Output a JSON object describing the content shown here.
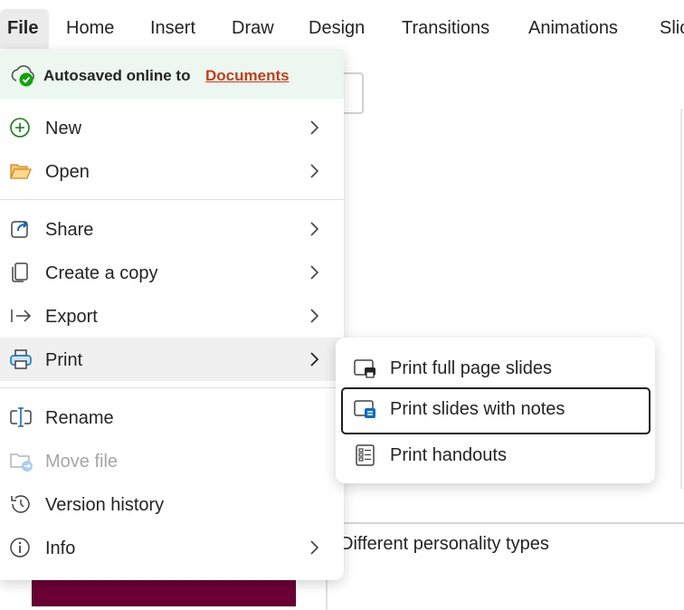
{
  "ribbon": {
    "tabs": [
      {
        "label": "File"
      },
      {
        "label": "Home"
      },
      {
        "label": "Insert"
      },
      {
        "label": "Draw"
      },
      {
        "label": "Design"
      },
      {
        "label": "Transitions"
      },
      {
        "label": "Animations"
      },
      {
        "label": "Slic"
      }
    ]
  },
  "file_menu": {
    "autosave": {
      "label": "Autosaved online to",
      "link": "Documents",
      "icon": "cloud-check-icon"
    },
    "items": [
      {
        "label": "New",
        "icon": "plus-circle-icon",
        "submenu": true
      },
      {
        "label": "Open",
        "icon": "folder-icon",
        "submenu": true
      },
      {
        "label": "Share",
        "icon": "share-icon",
        "submenu": true
      },
      {
        "label": "Create a copy",
        "icon": "copy-icon",
        "submenu": true
      },
      {
        "label": "Export",
        "icon": "export-arrow-icon",
        "submenu": true
      },
      {
        "label": "Print",
        "icon": "printer-icon",
        "submenu": true,
        "active": true
      },
      {
        "label": "Rename",
        "icon": "rename-icon",
        "submenu": false
      },
      {
        "label": "Move file",
        "icon": "move-file-icon",
        "submenu": false,
        "disabled": true
      },
      {
        "label": "Version history",
        "icon": "history-icon",
        "submenu": false
      },
      {
        "label": "Info",
        "icon": "info-icon",
        "submenu": true
      }
    ]
  },
  "print_submenu": {
    "items": [
      {
        "label": "Print full page slides",
        "icon": "print-full-page-icon"
      },
      {
        "label": "Print slides with notes",
        "icon": "print-notes-icon",
        "focused": true
      },
      {
        "label": "Print handouts",
        "icon": "handouts-icon"
      }
    ]
  },
  "slide_area": {
    "notes_text": "Different personality types"
  },
  "colors": {
    "autosave_bg": "#ebf7ef",
    "link": "#c43e1c",
    "accent_blue": "#0f6cbd",
    "new_green": "#107c10",
    "folder_orange": "#e8a33d",
    "thumbnail": "#6b0035"
  }
}
